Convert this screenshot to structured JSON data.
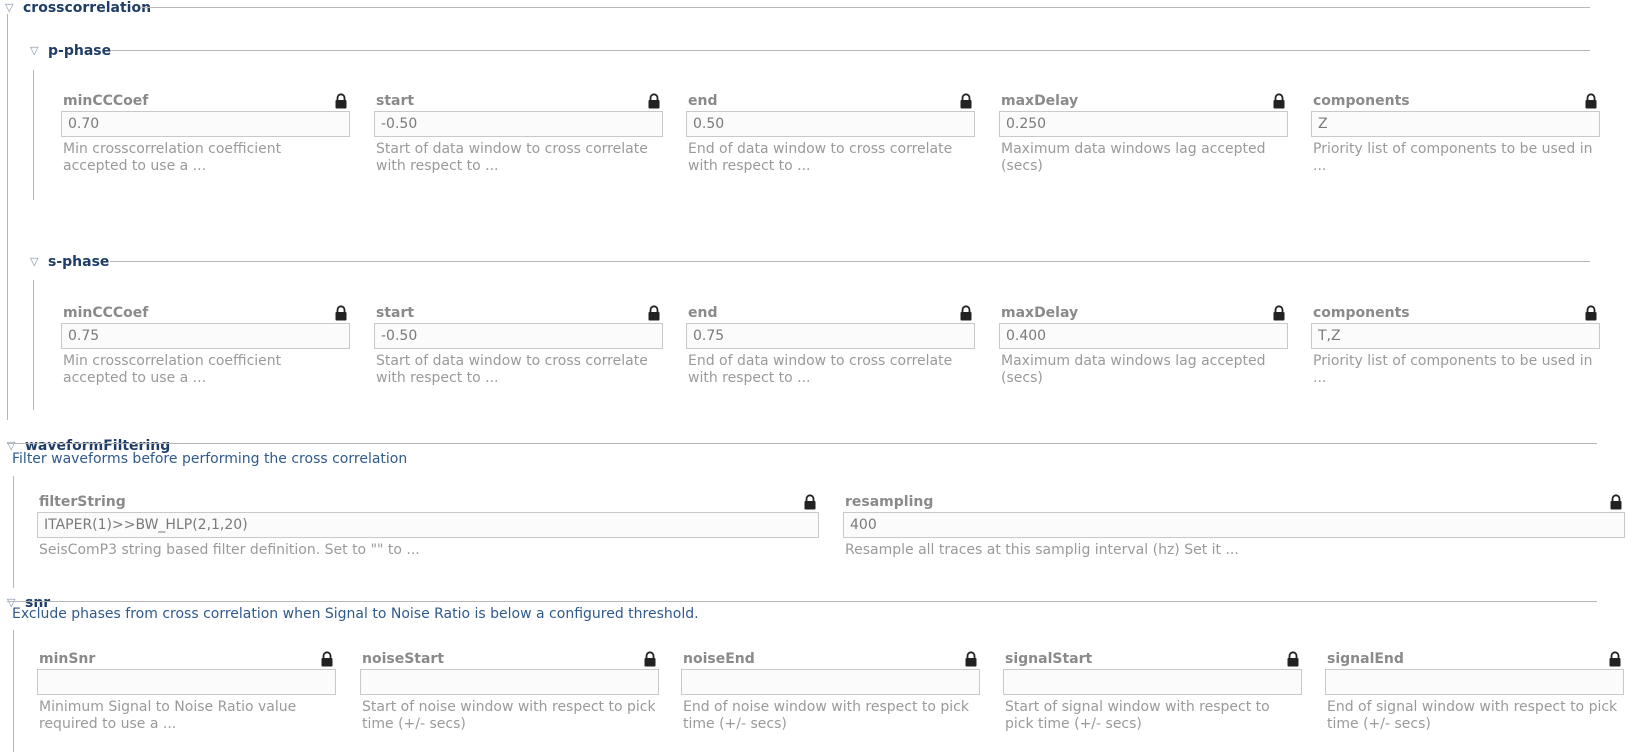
{
  "crosscorrelation": {
    "title": "crosscorrelation",
    "p_phase": {
      "title": "p-phase",
      "fields": [
        {
          "label": "minCCCoef",
          "value": "0.70",
          "desc": "Min crosscorrelation coefficient accepted to use a ..."
        },
        {
          "label": "start",
          "value": "-0.50",
          "desc": "Start of data window to cross correlate with respect to ..."
        },
        {
          "label": "end",
          "value": "0.50",
          "desc": "End of data window to cross correlate with respect to ..."
        },
        {
          "label": "maxDelay",
          "value": "0.250",
          "desc": "Maximum data windows lag accepted (secs)"
        },
        {
          "label": "components",
          "value": "Z",
          "desc": "Priority list of components to be used in ..."
        }
      ]
    },
    "s_phase": {
      "title": "s-phase",
      "fields": [
        {
          "label": "minCCCoef",
          "value": "0.75",
          "desc": "Min crosscorrelation coefficient accepted to use a ..."
        },
        {
          "label": "start",
          "value": "-0.50",
          "desc": "Start of data window to cross correlate with respect to ..."
        },
        {
          "label": "end",
          "value": "0.75",
          "desc": "End of data window to cross correlate with respect to ..."
        },
        {
          "label": "maxDelay",
          "value": "0.400",
          "desc": "Maximum data windows lag accepted (secs)"
        },
        {
          "label": "components",
          "value": "T,Z",
          "desc": "Priority list of components to be used in ..."
        }
      ]
    }
  },
  "waveformFiltering": {
    "title": "waveformFiltering",
    "description": "Filter waveforms before performing the cross correlation",
    "fields": [
      {
        "label": "filterString",
        "value": "ITAPER(1)>>BW_HLP(2,1,20)",
        "desc": "SeisComP3 string based filter definition. Set to \"\" to ..."
      },
      {
        "label": "resampling",
        "value": "400",
        "desc": "Resample all traces at this samplig interval (hz) Set it ..."
      }
    ]
  },
  "snr": {
    "title": "snr",
    "description": "Exclude phases from cross correlation when Signal to Noise Ratio is below a configured threshold.",
    "fields": [
      {
        "label": "minSnr",
        "value": "",
        "desc": "Minimum Signal to Noise Ratio value required to use a ..."
      },
      {
        "label": "noiseStart",
        "value": "",
        "desc": "Start of noise window with respect to pick time (+/- secs)"
      },
      {
        "label": "noiseEnd",
        "value": "",
        "desc": "End of noise window with respect to pick time (+/- secs)"
      },
      {
        "label": "signalStart",
        "value": "",
        "desc": "Start of signal window with respect to pick time (+/- secs)"
      },
      {
        "label": "signalEnd",
        "value": "",
        "desc": "End of signal window with respect to pick time (+/- secs)"
      }
    ]
  }
}
